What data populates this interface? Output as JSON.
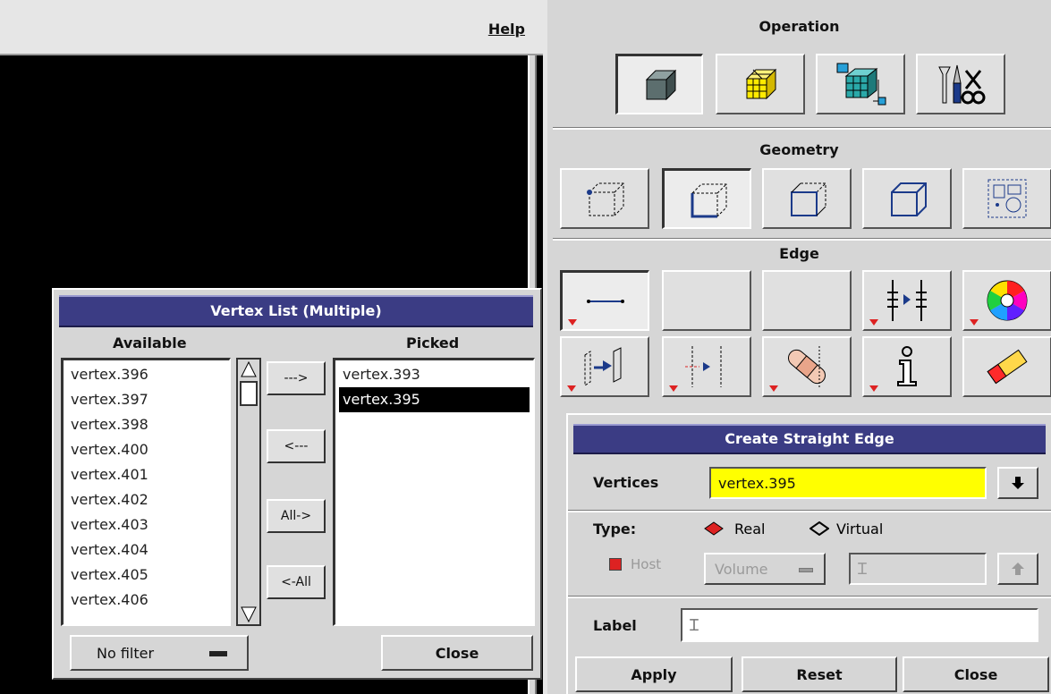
{
  "menubar": {
    "help_label": "Help"
  },
  "operation": {
    "title": "Operation",
    "buttons": [
      "geometry-cube-icon",
      "mesh-grid-icon",
      "zones-icon",
      "tools-icon"
    ]
  },
  "geometry": {
    "title": "Geometry"
  },
  "edge": {
    "title": "Edge"
  },
  "create_edge": {
    "title": "Create Straight Edge",
    "vertices_label": "Vertices",
    "vertices_value": "vertex.395",
    "type_label": "Type:",
    "type_real": "Real",
    "type_virtual": "Virtual",
    "host_label": "Host",
    "host_option": "Volume",
    "label_label": "Label",
    "label_value": "",
    "apply": "Apply",
    "reset": "Reset",
    "close": "Close",
    "field_color": "#ffff00"
  },
  "vertex_list": {
    "title": "Vertex List (Multiple)",
    "available_header": "Available",
    "picked_header": "Picked",
    "available": [
      "vertex.396",
      "vertex.397",
      "vertex.398",
      "vertex.400",
      "vertex.401",
      "vertex.402",
      "vertex.403",
      "vertex.404",
      "vertex.405",
      "vertex.406"
    ],
    "picked": [
      "vertex.393",
      "vertex.395"
    ],
    "selected_picked": "vertex.395",
    "btn_add": "--->",
    "btn_remove": "<---",
    "btn_add_all": "All->",
    "btn_remove_all": "<-All",
    "filter": "No filter",
    "close": "Close"
  },
  "colors": {
    "title_bar": "#3b3c84",
    "panel": "#d6d6d6",
    "accent_red": "#dd2222"
  }
}
